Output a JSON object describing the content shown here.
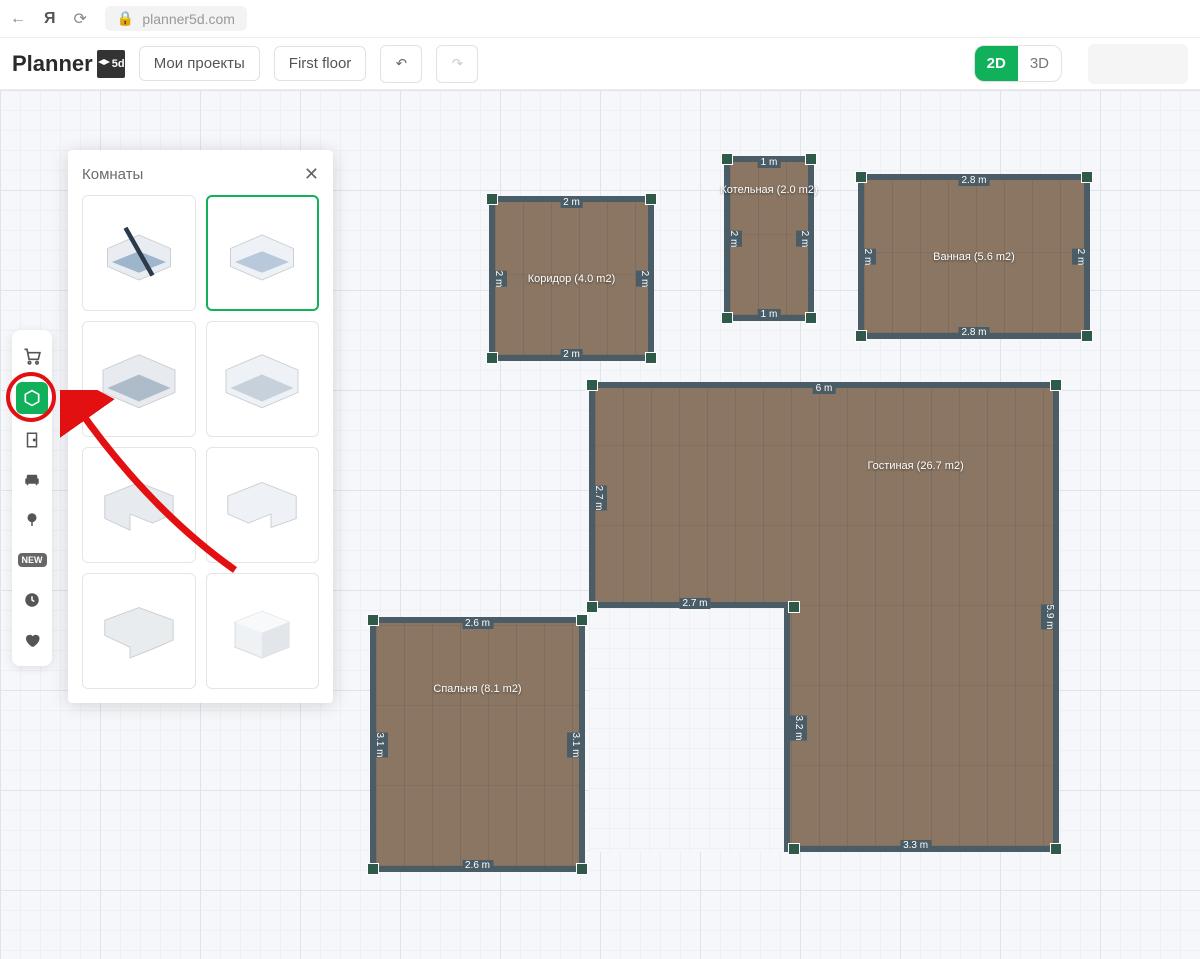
{
  "browser": {
    "url": "planner5d.com"
  },
  "logo": {
    "text": "Planner",
    "badge": "5d"
  },
  "header": {
    "projects": "Мои проекты",
    "floor": "First floor",
    "view2d": "2D",
    "view3d": "3D"
  },
  "toolbar": {
    "new_badge": "NEW"
  },
  "panel": {
    "title": "Комнаты"
  },
  "rooms": {
    "corridor": {
      "label": "Коридор (4.0 m2)",
      "w_top": "2 m",
      "w_bot": "2 m",
      "h_l": "2 m",
      "h_r": "2 m"
    },
    "boiler": {
      "label": "Котельная (2.0 m2)",
      "w_top": "1 m",
      "w_bot": "1 m",
      "h_l": "2 m",
      "h_r": "2 m"
    },
    "bath": {
      "label": "Ванная (5.6 m2)",
      "w_top": "2.8 m",
      "w_bot": "2.8 m",
      "h_l": "2 m",
      "h_r": "2 m"
    },
    "bedroom": {
      "label": "Спальня (8.1 m2)",
      "w_top": "2.6 m",
      "w_bot": "2.6 m",
      "h_l": "3.1 m",
      "h_r": "3.1 m"
    },
    "living": {
      "label": "Гостиная (26.7 m2)",
      "w_top": "6 m",
      "w_bot": "3.3 m",
      "h_l": "2.7 m",
      "h_r": "5.9 m",
      "cut_w": "2.7 m",
      "cut_h": "3.2 m"
    }
  }
}
